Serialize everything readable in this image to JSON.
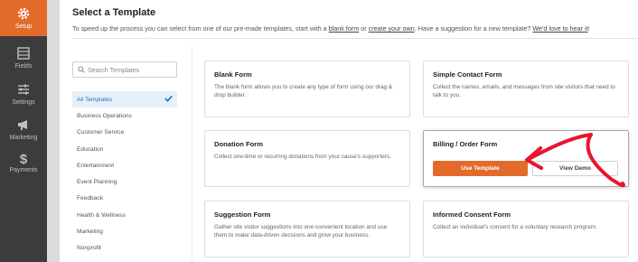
{
  "nav": {
    "items": [
      {
        "label": "Setup",
        "icon": "gear-icon"
      },
      {
        "label": "Fields",
        "icon": "fields-icon"
      },
      {
        "label": "Settings",
        "icon": "sliders-icon"
      },
      {
        "label": "Marketing",
        "icon": "megaphone-icon"
      },
      {
        "label": "Payments",
        "icon": "dollar-icon"
      }
    ],
    "dollar_glyph": "$"
  },
  "header": {
    "title": "Select a Template",
    "subtitle_before": "To speed up the process you can select from one of our pre-made templates, start with a ",
    "blank_form_link": "blank form",
    "subtitle_mid1": " or ",
    "create_own_link": "create your own",
    "subtitle_mid2": ". Have a suggestion for a new template? ",
    "love_link": "We'd love to hear it",
    "subtitle_end": "!"
  },
  "search": {
    "placeholder": "Search Templates"
  },
  "categories": [
    "All Templates",
    "Business Operations",
    "Customer Service",
    "Education",
    "Entertainment",
    "Event Planning",
    "Feedback",
    "Health & Wellness",
    "Marketing",
    "Nonprofit"
  ],
  "templates": [
    {
      "title": "Blank Form",
      "desc": "The blank form allows you to create any type of form using our drag & drop builder."
    },
    {
      "title": "Simple Contact Form",
      "desc": "Collect the names, emails, and messages from site visitors that need to talk to you."
    },
    {
      "title": "Donation Form",
      "desc": "Collect one-time or recurring donations from your cause's supporters."
    },
    {
      "title": "Billing / Order Form",
      "use_label": "Use Template",
      "demo_label": "View Demo"
    },
    {
      "title": "Suggestion Form",
      "desc": "Gather site visitor suggestions into one convenient location and use them to make data-driven decisions and grow your business."
    },
    {
      "title": "Informed Consent Form",
      "desc": "Collect an individual's consent for a voluntary research program."
    }
  ],
  "colors": {
    "accent": "#e26b2c",
    "sidebar": "#3c3c3c",
    "active_category": "#2a6fb5",
    "annotation_arrow": "#e8162b"
  }
}
